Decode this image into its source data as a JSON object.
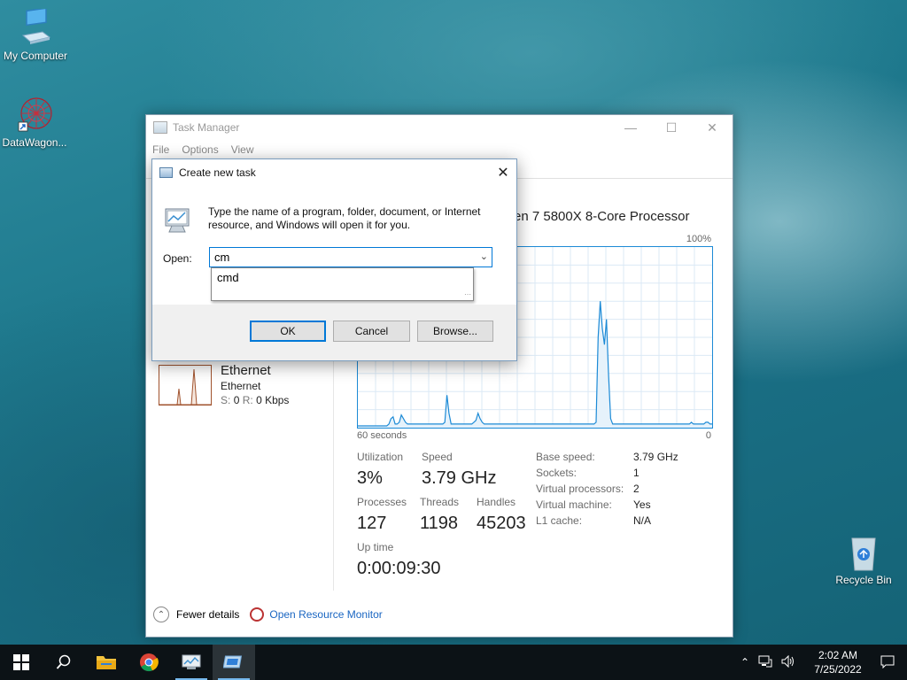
{
  "desktop": {
    "icons": [
      {
        "label": "My Computer",
        "icon": "computer-icon"
      },
      {
        "label": "DataWagon...",
        "icon": "datawagon-icon"
      },
      {
        "label": "Recycle Bin",
        "icon": "recycle-bin-icon"
      }
    ]
  },
  "task_manager": {
    "title": "Task Manager",
    "menu": [
      "File",
      "Options",
      "View"
    ],
    "cpu_name": "yzen 7 5800X 8-Core Processor",
    "graph_max": "100%",
    "graph_left": "60 seconds",
    "graph_right": "0",
    "cpu_utilization_series": [
      1,
      1,
      1,
      1,
      1,
      1,
      1,
      1,
      1,
      1,
      1,
      1,
      1,
      1,
      1,
      2,
      5,
      6,
      2,
      2,
      3,
      7,
      5,
      3,
      2,
      2,
      2,
      2,
      2,
      2,
      2,
      2,
      2,
      2,
      2,
      2,
      2,
      2,
      2,
      2,
      2,
      2,
      3,
      18,
      8,
      2,
      2,
      2,
      2,
      2,
      2,
      2,
      2,
      2,
      2,
      2,
      3,
      4,
      8,
      5,
      3,
      2,
      2,
      2,
      2,
      2,
      2,
      2,
      2,
      2,
      2,
      2,
      2,
      2,
      2,
      2,
      2,
      2,
      2,
      2,
      2,
      2,
      2,
      2,
      2,
      2,
      2,
      2,
      2,
      2,
      2,
      2,
      2,
      2,
      2,
      2,
      2,
      2,
      2,
      2,
      2,
      2,
      2,
      2,
      2,
      2,
      2,
      2,
      2,
      2,
      2,
      2,
      2,
      2,
      2,
      3,
      50,
      70,
      55,
      46,
      60,
      30,
      5,
      2,
      2,
      2,
      2,
      2,
      2,
      2,
      2,
      2,
      2,
      2,
      2,
      2,
      2,
      2,
      2,
      2,
      2,
      2,
      2,
      2,
      2,
      2,
      2,
      2,
      2,
      2,
      2,
      2,
      2,
      2,
      2,
      2,
      2,
      2,
      2,
      2,
      2,
      3,
      2,
      2,
      2,
      2,
      2,
      2,
      3,
      3,
      2,
      2
    ],
    "ethernet": {
      "title": "Ethernet",
      "subtitle": "Ethernet",
      "send_label": "S:",
      "send_value": "0",
      "recv_label": "R:",
      "recv_value": "0 Kbps"
    },
    "stats": {
      "utilization_label": "Utilization",
      "utilization_value": "3%",
      "speed_label": "Speed",
      "speed_value": "3.79 GHz",
      "processes_label": "Processes",
      "processes_value": "127",
      "threads_label": "Threads",
      "threads_value": "1198",
      "handles_label": "Handles",
      "handles_value": "45203",
      "uptime_label": "Up time",
      "uptime_value": "0:00:09:30"
    },
    "props": [
      {
        "k": "Base speed:",
        "v": "3.79 GHz"
      },
      {
        "k": "Sockets:",
        "v": "1"
      },
      {
        "k": "Virtual processors:",
        "v": "2"
      },
      {
        "k": "Virtual machine:",
        "v": "Yes"
      },
      {
        "k": "L1 cache:",
        "v": "N/A"
      }
    ],
    "fewer_details": "Fewer details",
    "open_resource_monitor": "Open Resource Monitor"
  },
  "run_dialog": {
    "title": "Create new task",
    "description": "Type the name of a program, folder, document, or Internet resource, and Windows will open it for you.",
    "open_label": "Open:",
    "input_value": "cm",
    "suggestion": "cmd",
    "ok_label": "OK",
    "cancel_label": "Cancel",
    "browse_label": "Browse..."
  },
  "taskbar": {
    "time": "2:02 AM",
    "date": "7/25/2022"
  },
  "colors": {
    "accent": "#0078d7",
    "graph_line": "#1c8ad6",
    "graph_fill": "#e6f2fb",
    "link": "#1a66c2"
  }
}
